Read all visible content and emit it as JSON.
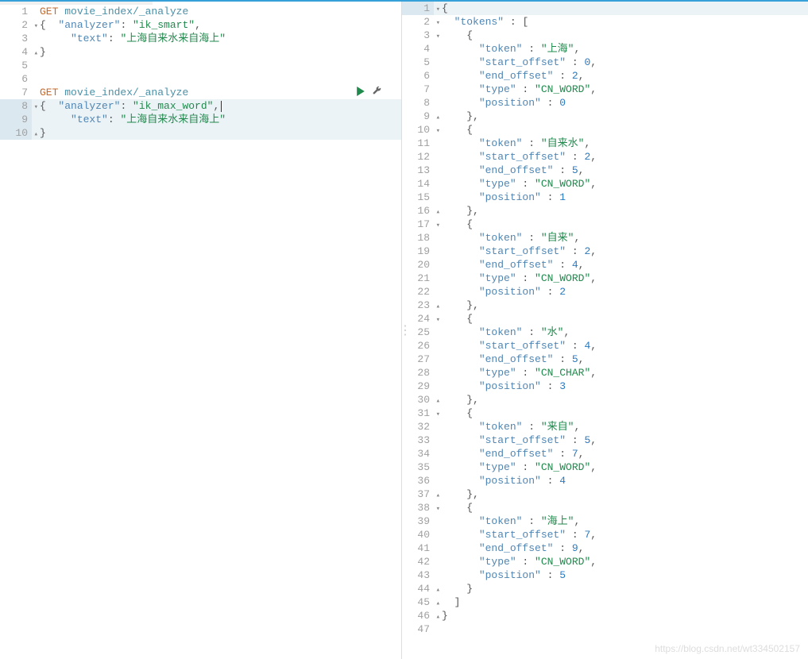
{
  "left": {
    "start_line": 1,
    "highlight_lines": [
      8,
      9,
      10
    ],
    "action_line": 7,
    "lines": [
      {
        "t": [
          {
            "c": "method",
            "v": "GET"
          },
          {
            "c": "",
            "v": " "
          },
          {
            "c": "url",
            "v": "movie_index/_analyze"
          }
        ]
      },
      {
        "fold": "▾",
        "t": [
          {
            "c": "brace",
            "v": "{"
          },
          {
            "c": "",
            "v": "  "
          },
          {
            "c": "key",
            "v": "\"analyzer\""
          },
          {
            "c": "punct",
            "v": ": "
          },
          {
            "c": "string",
            "v": "\"ik_smart\""
          },
          {
            "c": "punct",
            "v": ","
          }
        ]
      },
      {
        "t": [
          {
            "c": "",
            "v": "     "
          },
          {
            "c": "key",
            "v": "\"text\""
          },
          {
            "c": "punct",
            "v": ": "
          },
          {
            "c": "string",
            "v": "\"上海自来水来自海上\""
          }
        ]
      },
      {
        "fold": "▴",
        "t": [
          {
            "c": "brace",
            "v": "}"
          }
        ]
      },
      {
        "t": []
      },
      {
        "t": []
      },
      {
        "t": [
          {
            "c": "method",
            "v": "GET"
          },
          {
            "c": "",
            "v": " "
          },
          {
            "c": "url",
            "v": "movie_index/_analyze"
          }
        ]
      },
      {
        "fold": "▾",
        "cursor": true,
        "t": [
          {
            "c": "brace",
            "v": "{"
          },
          {
            "c": "",
            "v": "  "
          },
          {
            "c": "key",
            "v": "\"analyzer\""
          },
          {
            "c": "punct",
            "v": ": "
          },
          {
            "c": "string",
            "v": "\"ik_max_word\""
          },
          {
            "c": "punct",
            "v": ","
          }
        ]
      },
      {
        "t": [
          {
            "c": "",
            "v": "     "
          },
          {
            "c": "key",
            "v": "\"text\""
          },
          {
            "c": "punct",
            "v": ": "
          },
          {
            "c": "string",
            "v": "\"上海自来水来自海上\""
          }
        ]
      },
      {
        "fold": "▴",
        "t": [
          {
            "c": "brace",
            "v": "}"
          }
        ]
      }
    ]
  },
  "right": {
    "start_line": 1,
    "highlight_lines": [
      1
    ],
    "lines": [
      {
        "fold": "▾",
        "t": [
          {
            "c": "brace",
            "v": "{"
          }
        ]
      },
      {
        "fold": "▾",
        "t": [
          {
            "c": "",
            "v": "  "
          },
          {
            "c": "key",
            "v": "\"tokens\""
          },
          {
            "c": "punct",
            "v": " : "
          },
          {
            "c": "brace",
            "v": "["
          }
        ]
      },
      {
        "fold": "▾",
        "t": [
          {
            "c": "",
            "v": "    "
          },
          {
            "c": "brace",
            "v": "{"
          }
        ]
      },
      {
        "t": [
          {
            "c": "",
            "v": "      "
          },
          {
            "c": "key",
            "v": "\"token\""
          },
          {
            "c": "punct",
            "v": " : "
          },
          {
            "c": "string",
            "v": "\"上海\""
          },
          {
            "c": "punct",
            "v": ","
          }
        ]
      },
      {
        "t": [
          {
            "c": "",
            "v": "      "
          },
          {
            "c": "key",
            "v": "\"start_offset\""
          },
          {
            "c": "punct",
            "v": " : "
          },
          {
            "c": "num",
            "v": "0"
          },
          {
            "c": "punct",
            "v": ","
          }
        ]
      },
      {
        "t": [
          {
            "c": "",
            "v": "      "
          },
          {
            "c": "key",
            "v": "\"end_offset\""
          },
          {
            "c": "punct",
            "v": " : "
          },
          {
            "c": "num",
            "v": "2"
          },
          {
            "c": "punct",
            "v": ","
          }
        ]
      },
      {
        "t": [
          {
            "c": "",
            "v": "      "
          },
          {
            "c": "key",
            "v": "\"type\""
          },
          {
            "c": "punct",
            "v": " : "
          },
          {
            "c": "string",
            "v": "\"CN_WORD\""
          },
          {
            "c": "punct",
            "v": ","
          }
        ]
      },
      {
        "t": [
          {
            "c": "",
            "v": "      "
          },
          {
            "c": "key",
            "v": "\"position\""
          },
          {
            "c": "punct",
            "v": " : "
          },
          {
            "c": "num",
            "v": "0"
          }
        ]
      },
      {
        "fold": "▴",
        "t": [
          {
            "c": "",
            "v": "    "
          },
          {
            "c": "brace",
            "v": "}"
          },
          {
            "c": "punct",
            "v": ","
          }
        ]
      },
      {
        "fold": "▾",
        "t": [
          {
            "c": "",
            "v": "    "
          },
          {
            "c": "brace",
            "v": "{"
          }
        ]
      },
      {
        "t": [
          {
            "c": "",
            "v": "      "
          },
          {
            "c": "key",
            "v": "\"token\""
          },
          {
            "c": "punct",
            "v": " : "
          },
          {
            "c": "string",
            "v": "\"自来水\""
          },
          {
            "c": "punct",
            "v": ","
          }
        ]
      },
      {
        "t": [
          {
            "c": "",
            "v": "      "
          },
          {
            "c": "key",
            "v": "\"start_offset\""
          },
          {
            "c": "punct",
            "v": " : "
          },
          {
            "c": "num",
            "v": "2"
          },
          {
            "c": "punct",
            "v": ","
          }
        ]
      },
      {
        "t": [
          {
            "c": "",
            "v": "      "
          },
          {
            "c": "key",
            "v": "\"end_offset\""
          },
          {
            "c": "punct",
            "v": " : "
          },
          {
            "c": "num",
            "v": "5"
          },
          {
            "c": "punct",
            "v": ","
          }
        ]
      },
      {
        "t": [
          {
            "c": "",
            "v": "      "
          },
          {
            "c": "key",
            "v": "\"type\""
          },
          {
            "c": "punct",
            "v": " : "
          },
          {
            "c": "string",
            "v": "\"CN_WORD\""
          },
          {
            "c": "punct",
            "v": ","
          }
        ]
      },
      {
        "t": [
          {
            "c": "",
            "v": "      "
          },
          {
            "c": "key",
            "v": "\"position\""
          },
          {
            "c": "punct",
            "v": " : "
          },
          {
            "c": "num",
            "v": "1"
          }
        ]
      },
      {
        "fold": "▴",
        "t": [
          {
            "c": "",
            "v": "    "
          },
          {
            "c": "brace",
            "v": "}"
          },
          {
            "c": "punct",
            "v": ","
          }
        ]
      },
      {
        "fold": "▾",
        "t": [
          {
            "c": "",
            "v": "    "
          },
          {
            "c": "brace",
            "v": "{"
          }
        ]
      },
      {
        "t": [
          {
            "c": "",
            "v": "      "
          },
          {
            "c": "key",
            "v": "\"token\""
          },
          {
            "c": "punct",
            "v": " : "
          },
          {
            "c": "string",
            "v": "\"自来\""
          },
          {
            "c": "punct",
            "v": ","
          }
        ]
      },
      {
        "t": [
          {
            "c": "",
            "v": "      "
          },
          {
            "c": "key",
            "v": "\"start_offset\""
          },
          {
            "c": "punct",
            "v": " : "
          },
          {
            "c": "num",
            "v": "2"
          },
          {
            "c": "punct",
            "v": ","
          }
        ]
      },
      {
        "t": [
          {
            "c": "",
            "v": "      "
          },
          {
            "c": "key",
            "v": "\"end_offset\""
          },
          {
            "c": "punct",
            "v": " : "
          },
          {
            "c": "num",
            "v": "4"
          },
          {
            "c": "punct",
            "v": ","
          }
        ]
      },
      {
        "t": [
          {
            "c": "",
            "v": "      "
          },
          {
            "c": "key",
            "v": "\"type\""
          },
          {
            "c": "punct",
            "v": " : "
          },
          {
            "c": "string",
            "v": "\"CN_WORD\""
          },
          {
            "c": "punct",
            "v": ","
          }
        ]
      },
      {
        "t": [
          {
            "c": "",
            "v": "      "
          },
          {
            "c": "key",
            "v": "\"position\""
          },
          {
            "c": "punct",
            "v": " : "
          },
          {
            "c": "num",
            "v": "2"
          }
        ]
      },
      {
        "fold": "▴",
        "t": [
          {
            "c": "",
            "v": "    "
          },
          {
            "c": "brace",
            "v": "}"
          },
          {
            "c": "punct",
            "v": ","
          }
        ]
      },
      {
        "fold": "▾",
        "t": [
          {
            "c": "",
            "v": "    "
          },
          {
            "c": "brace",
            "v": "{"
          }
        ]
      },
      {
        "t": [
          {
            "c": "",
            "v": "      "
          },
          {
            "c": "key",
            "v": "\"token\""
          },
          {
            "c": "punct",
            "v": " : "
          },
          {
            "c": "string",
            "v": "\"水\""
          },
          {
            "c": "punct",
            "v": ","
          }
        ]
      },
      {
        "t": [
          {
            "c": "",
            "v": "      "
          },
          {
            "c": "key",
            "v": "\"start_offset\""
          },
          {
            "c": "punct",
            "v": " : "
          },
          {
            "c": "num",
            "v": "4"
          },
          {
            "c": "punct",
            "v": ","
          }
        ]
      },
      {
        "t": [
          {
            "c": "",
            "v": "      "
          },
          {
            "c": "key",
            "v": "\"end_offset\""
          },
          {
            "c": "punct",
            "v": " : "
          },
          {
            "c": "num",
            "v": "5"
          },
          {
            "c": "punct",
            "v": ","
          }
        ]
      },
      {
        "t": [
          {
            "c": "",
            "v": "      "
          },
          {
            "c": "key",
            "v": "\"type\""
          },
          {
            "c": "punct",
            "v": " : "
          },
          {
            "c": "string",
            "v": "\"CN_CHAR\""
          },
          {
            "c": "punct",
            "v": ","
          }
        ]
      },
      {
        "t": [
          {
            "c": "",
            "v": "      "
          },
          {
            "c": "key",
            "v": "\"position\""
          },
          {
            "c": "punct",
            "v": " : "
          },
          {
            "c": "num",
            "v": "3"
          }
        ]
      },
      {
        "fold": "▴",
        "t": [
          {
            "c": "",
            "v": "    "
          },
          {
            "c": "brace",
            "v": "}"
          },
          {
            "c": "punct",
            "v": ","
          }
        ]
      },
      {
        "fold": "▾",
        "t": [
          {
            "c": "",
            "v": "    "
          },
          {
            "c": "brace",
            "v": "{"
          }
        ]
      },
      {
        "t": [
          {
            "c": "",
            "v": "      "
          },
          {
            "c": "key",
            "v": "\"token\""
          },
          {
            "c": "punct",
            "v": " : "
          },
          {
            "c": "string",
            "v": "\"来自\""
          },
          {
            "c": "punct",
            "v": ","
          }
        ]
      },
      {
        "t": [
          {
            "c": "",
            "v": "      "
          },
          {
            "c": "key",
            "v": "\"start_offset\""
          },
          {
            "c": "punct",
            "v": " : "
          },
          {
            "c": "num",
            "v": "5"
          },
          {
            "c": "punct",
            "v": ","
          }
        ]
      },
      {
        "t": [
          {
            "c": "",
            "v": "      "
          },
          {
            "c": "key",
            "v": "\"end_offset\""
          },
          {
            "c": "punct",
            "v": " : "
          },
          {
            "c": "num",
            "v": "7"
          },
          {
            "c": "punct",
            "v": ","
          }
        ]
      },
      {
        "t": [
          {
            "c": "",
            "v": "      "
          },
          {
            "c": "key",
            "v": "\"type\""
          },
          {
            "c": "punct",
            "v": " : "
          },
          {
            "c": "string",
            "v": "\"CN_WORD\""
          },
          {
            "c": "punct",
            "v": ","
          }
        ]
      },
      {
        "t": [
          {
            "c": "",
            "v": "      "
          },
          {
            "c": "key",
            "v": "\"position\""
          },
          {
            "c": "punct",
            "v": " : "
          },
          {
            "c": "num",
            "v": "4"
          }
        ]
      },
      {
        "fold": "▴",
        "t": [
          {
            "c": "",
            "v": "    "
          },
          {
            "c": "brace",
            "v": "}"
          },
          {
            "c": "punct",
            "v": ","
          }
        ]
      },
      {
        "fold": "▾",
        "t": [
          {
            "c": "",
            "v": "    "
          },
          {
            "c": "brace",
            "v": "{"
          }
        ]
      },
      {
        "t": [
          {
            "c": "",
            "v": "      "
          },
          {
            "c": "key",
            "v": "\"token\""
          },
          {
            "c": "punct",
            "v": " : "
          },
          {
            "c": "string",
            "v": "\"海上\""
          },
          {
            "c": "punct",
            "v": ","
          }
        ]
      },
      {
        "t": [
          {
            "c": "",
            "v": "      "
          },
          {
            "c": "key",
            "v": "\"start_offset\""
          },
          {
            "c": "punct",
            "v": " : "
          },
          {
            "c": "num",
            "v": "7"
          },
          {
            "c": "punct",
            "v": ","
          }
        ]
      },
      {
        "t": [
          {
            "c": "",
            "v": "      "
          },
          {
            "c": "key",
            "v": "\"end_offset\""
          },
          {
            "c": "punct",
            "v": " : "
          },
          {
            "c": "num",
            "v": "9"
          },
          {
            "c": "punct",
            "v": ","
          }
        ]
      },
      {
        "t": [
          {
            "c": "",
            "v": "      "
          },
          {
            "c": "key",
            "v": "\"type\""
          },
          {
            "c": "punct",
            "v": " : "
          },
          {
            "c": "string",
            "v": "\"CN_WORD\""
          },
          {
            "c": "punct",
            "v": ","
          }
        ]
      },
      {
        "t": [
          {
            "c": "",
            "v": "      "
          },
          {
            "c": "key",
            "v": "\"position\""
          },
          {
            "c": "punct",
            "v": " : "
          },
          {
            "c": "num",
            "v": "5"
          }
        ]
      },
      {
        "fold": "▴",
        "t": [
          {
            "c": "",
            "v": "    "
          },
          {
            "c": "brace",
            "v": "}"
          }
        ]
      },
      {
        "fold": "▴",
        "t": [
          {
            "c": "",
            "v": "  "
          },
          {
            "c": "brace",
            "v": "]"
          }
        ]
      },
      {
        "fold": "▴",
        "t": [
          {
            "c": "brace",
            "v": "}"
          }
        ]
      },
      {
        "t": []
      }
    ]
  },
  "watermark": "https://blog.csdn.net/wt334502157"
}
